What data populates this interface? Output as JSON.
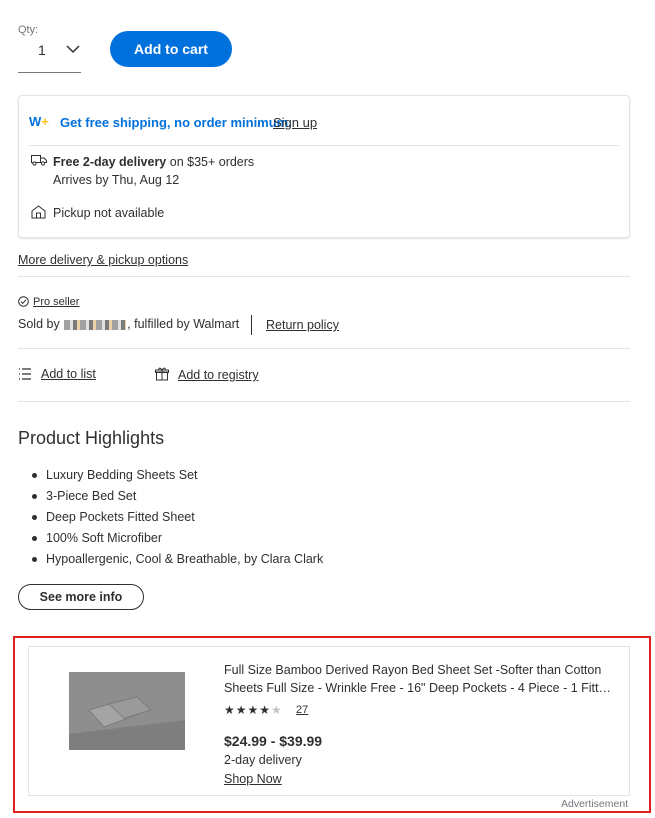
{
  "quantity": {
    "label": "Qty:",
    "value": "1"
  },
  "add_to_cart_label": "Add to cart",
  "delivery_card": {
    "wplus_logo": "W+",
    "free_shipping_text": "Get free shipping, no order minimum.",
    "signup_label": "Sign up",
    "delivery_bold": "Free 2-day delivery",
    "delivery_rest": " on $35+ orders",
    "arrival": "Arrives by Thu, Aug 12",
    "pickup": "Pickup not available"
  },
  "more_delivery_label": "More delivery & pickup options",
  "seller": {
    "pro_seller_label": "Pro seller",
    "sold_by_prefix": "Sold by",
    "fulfilled_text": ", fulfilled by Walmart",
    "return_policy_label": "Return policy"
  },
  "actions": {
    "add_to_list": "Add to list",
    "add_to_registry": "Add to registry"
  },
  "highlights": {
    "title": "Product Highlights",
    "items": [
      "Luxury Bedding Sheets Set",
      "3-Piece Bed Set",
      "Deep Pockets Fitted Sheet",
      "100% Soft Microfiber",
      "Hypoallergenic, Cool & Breathable, by Clara Clark"
    ],
    "see_more_label": "See more info"
  },
  "ad": {
    "title_line1": "Full Size Bamboo Derived Rayon Bed Sheet Set -Softer than Cotton",
    "title_line2": "Sheets Full Size - Wrinkle Free - 16\" Deep Pockets - 4 Piece - 1 Fitted...",
    "stars_filled": "★★★★",
    "stars_empty": "★",
    "rating": 4,
    "reviews": "27",
    "price": "$24.99 - $39.99",
    "delivery": "2-day delivery",
    "shop_now": "Shop Now",
    "label": "Advertisement"
  },
  "colors": {
    "primary": "#0071dc",
    "spark": "#ffc220",
    "ad_outline": "#e0201e",
    "text": "#2e2f32"
  }
}
